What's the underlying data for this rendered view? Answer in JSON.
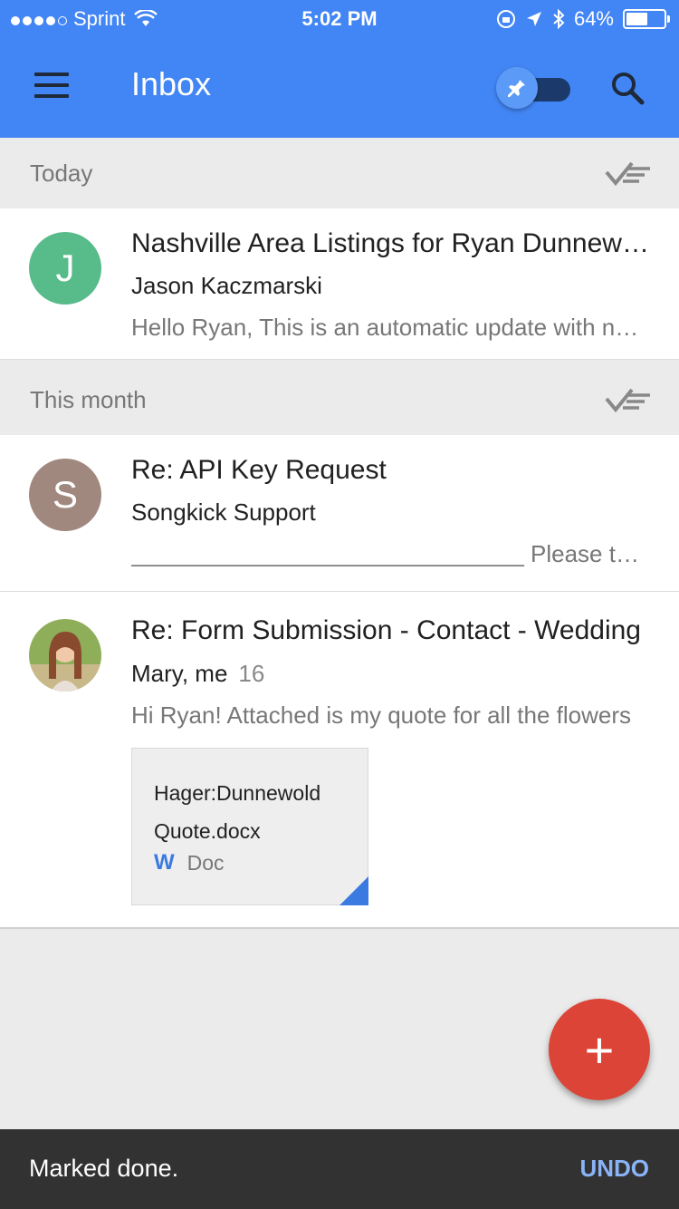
{
  "status_bar": {
    "carrier": "Sprint",
    "time": "5:02 PM",
    "battery": "64%",
    "battery_level": 0.64
  },
  "app": {
    "title": "Inbox"
  },
  "sections": {
    "today": "Today",
    "this_month": "This month"
  },
  "emails": [
    {
      "initial": "J",
      "avatar_color": "#57bb8a",
      "subject": "Nashville Area Listings for Ryan Dunnewold",
      "sender": "Jason Kaczmarski",
      "snippet": "Hello Ryan, This is an automatic update with new listings"
    },
    {
      "initial": "S",
      "avatar_color": "#a1887f",
      "subject": "Re: API Key Request",
      "sender": "Songkick Support",
      "snippet": "______________________________ Please type your reply"
    },
    {
      "initial": "",
      "avatar_color": "#6b8e3e",
      "subject": "Re: Form Submission - Contact - Wedding",
      "sender": "Mary, me",
      "count": "16",
      "snippet": "Hi Ryan! Attached is my quote for all the flowers",
      "attachment": {
        "name": "Hager:Dunnewold Quote.docx",
        "type": "Doc",
        "type_icon": "W"
      }
    }
  ],
  "fab": {
    "label": "+"
  },
  "snackbar": {
    "message": "Marked done.",
    "action": "UNDO"
  }
}
